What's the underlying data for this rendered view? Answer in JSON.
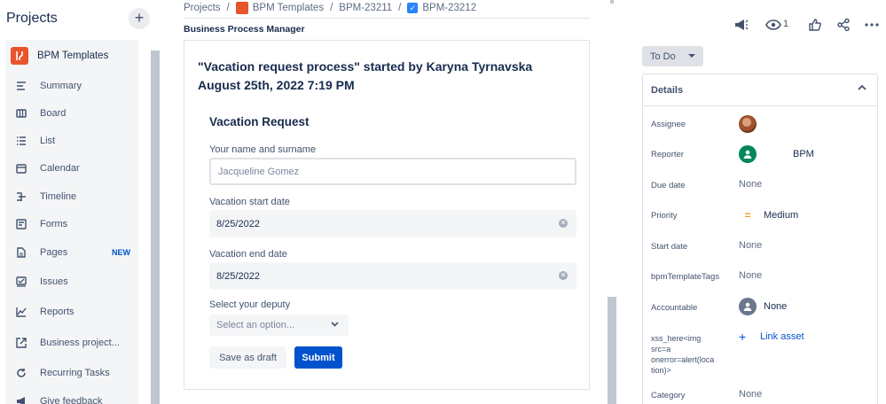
{
  "sidebar": {
    "title": "Projects",
    "add_label": "+",
    "project_name": "BPM Templates",
    "items": [
      {
        "label": "Summary",
        "icon": "summary-icon"
      },
      {
        "label": "Board",
        "icon": "board-icon"
      },
      {
        "label": "List",
        "icon": "list-icon"
      },
      {
        "label": "Calendar",
        "icon": "calendar-icon"
      },
      {
        "label": "Timeline",
        "icon": "timeline-icon"
      },
      {
        "label": "Forms",
        "icon": "forms-icon"
      },
      {
        "label": "Pages",
        "icon": "pages-icon",
        "badge": "NEW"
      },
      {
        "label": "Issues",
        "icon": "issues-icon"
      },
      {
        "label": "Reports",
        "icon": "reports-icon"
      },
      {
        "label": "Business project...",
        "icon": "external-link-icon"
      },
      {
        "label": "Recurring Tasks",
        "icon": "recurring-icon"
      },
      {
        "label": "Give feedback",
        "icon": "megaphone-icon"
      }
    ]
  },
  "breadcrumb": {
    "root": "Projects",
    "project": "BPM Templates",
    "parent": "BPM-23211",
    "current": "BPM-23212",
    "separator": "/"
  },
  "main": {
    "section_label": "Business Process Manager",
    "title": "\"Vacation request process\" started by Karyna Tyrnavska August 25th, 2022 7:19 PM",
    "form": {
      "title": "Vacation Request",
      "name_label": "Your name and surname",
      "name_placeholder": "Jacqueline Gomez",
      "start_label": "Vacation start date",
      "start_value": "8/25/2022",
      "end_label": "Vacation end date",
      "end_value": "8/25/2022",
      "deputy_label": "Select your deputy",
      "deputy_placeholder": "Select an option...",
      "draft_label": "Save as draft",
      "submit_label": "Submit"
    }
  },
  "toolbar": {
    "watch_count": "1"
  },
  "status": {
    "label": "To Do"
  },
  "details": {
    "title": "Details",
    "assignee_label": "Assignee",
    "reporter_label": "Reporter",
    "reporter_value": "BPM",
    "due_label": "Due date",
    "due_value": "None",
    "priority_label": "Priority",
    "priority_value": "Medium",
    "start_label": "Start date",
    "start_value": "None",
    "tags_label": "bpmTemplateTags",
    "tags_value": "None",
    "accountable_label": "Accountable",
    "accountable_value": "None",
    "xss_label_1": "xss_here<img",
    "xss_label_2": "src=a",
    "xss_label_3": "onerror=alert(loca",
    "xss_label_4": "tion)>",
    "link_label": "Link asset",
    "category_label": "Category",
    "category_value": "None"
  },
  "colors": {
    "accent": "#0052cc",
    "project_icon": "#e8542b",
    "priority_medium": "#ff991f",
    "reporter_avatar": "#00875a"
  }
}
